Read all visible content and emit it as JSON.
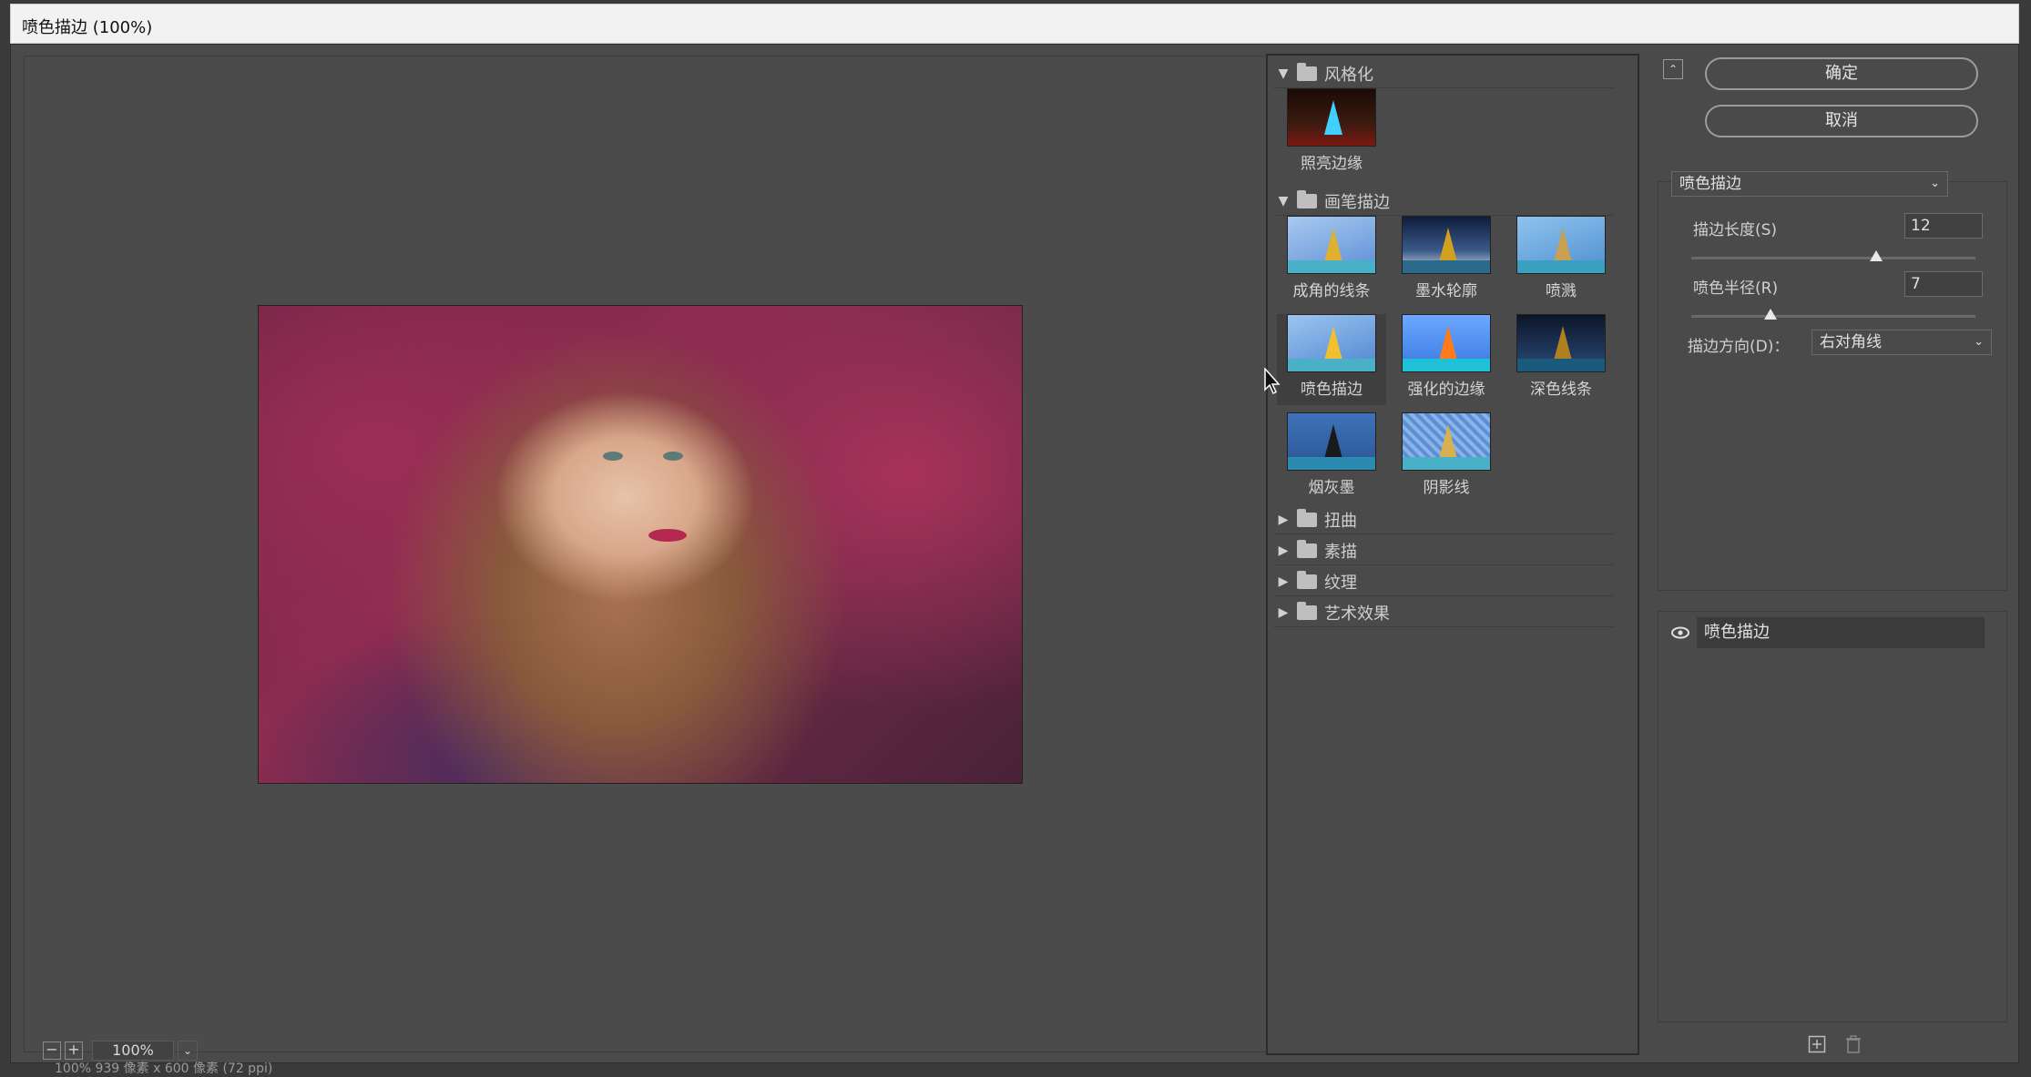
{
  "window": {
    "title": "喷色描边 (100%)"
  },
  "preview": {
    "zoom": "100%"
  },
  "gallery": {
    "categories": [
      {
        "name": "风格化",
        "expanded": true,
        "filters": [
          {
            "label": "照亮边缘"
          }
        ]
      },
      {
        "name": "画笔描边",
        "expanded": true,
        "filters": [
          {
            "label": "成角的线条"
          },
          {
            "label": "墨水轮廓"
          },
          {
            "label": "喷溅"
          },
          {
            "label": "喷色描边",
            "selected": true
          },
          {
            "label": "强化的边缘"
          },
          {
            "label": "深色线条"
          },
          {
            "label": "烟灰墨"
          },
          {
            "label": "阴影线"
          }
        ]
      },
      {
        "name": "扭曲",
        "expanded": false
      },
      {
        "name": "素描",
        "expanded": false
      },
      {
        "name": "纹理",
        "expanded": false
      },
      {
        "name": "艺术效果",
        "expanded": false
      }
    ]
  },
  "buttons": {
    "ok": "确定",
    "cancel": "取消"
  },
  "settings": {
    "filter_select": "喷色描边",
    "stroke_length": {
      "label": "描边长度(S)",
      "value": "12",
      "level": 0.65
    },
    "spray_radius": {
      "label": "喷色半径(R)",
      "value": "7",
      "level": 0.28
    },
    "stroke_direction": {
      "label": "描边方向(D)：",
      "value": "右对角线"
    }
  },
  "layers": {
    "items": [
      {
        "name": "喷色描边",
        "visible": true
      }
    ]
  },
  "status": {
    "text": "100%    939 像素 x 600 像素 (72 ppi)"
  }
}
